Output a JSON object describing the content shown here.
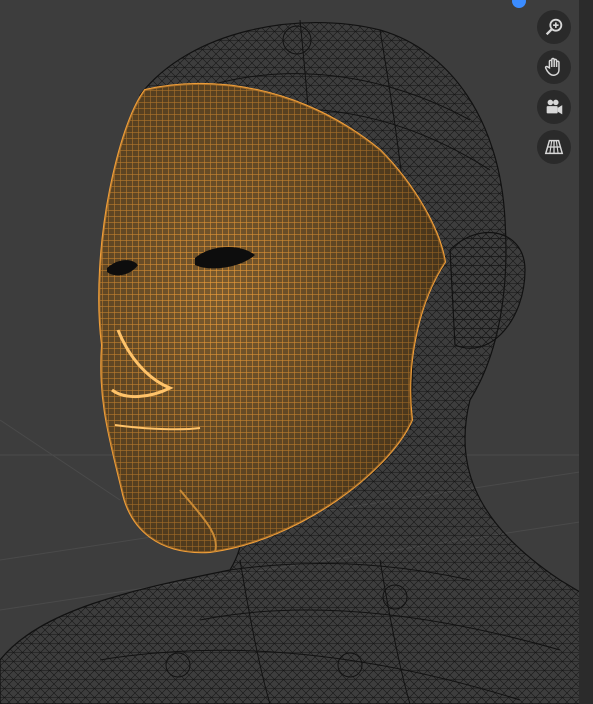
{
  "viewport": {
    "background_color": "#3d3d3d",
    "wire_color": "#111111",
    "selected_color": "#f2a03a",
    "axis_dot_color": "#3b8cff"
  },
  "nav_gizmo": {
    "buttons": [
      {
        "name": "zoom",
        "icon": "zoom-in-icon"
      },
      {
        "name": "pan",
        "icon": "hand-icon"
      },
      {
        "name": "camera",
        "icon": "camera-icon"
      },
      {
        "name": "perspective",
        "icon": "grid-icon"
      }
    ]
  }
}
